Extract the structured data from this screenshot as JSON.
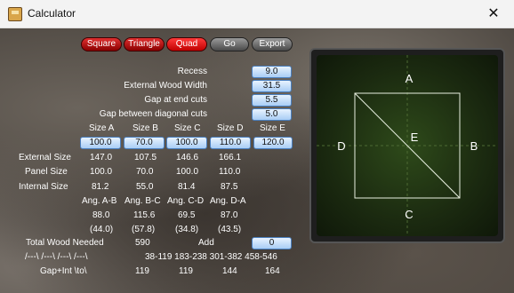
{
  "window": {
    "title": "Calculator",
    "close_glyph": "✕"
  },
  "toolbar": {
    "square": "Square",
    "triangle": "Triangle",
    "quad": "Quad",
    "go": "Go",
    "export": "Export"
  },
  "params": [
    {
      "label": "Recess",
      "value": "9.0"
    },
    {
      "label": "External Wood Width",
      "value": "31.5"
    },
    {
      "label": "Gap at end cuts",
      "value": "5.5"
    },
    {
      "label": "Gap between diagonal cuts",
      "value": "5.0"
    }
  ],
  "sizes": {
    "headers": [
      "Size A",
      "Size B",
      "Size C",
      "Size D",
      "Size E"
    ],
    "inputs": [
      "100.0",
      "70.0",
      "100.0",
      "110.0",
      "120.0"
    ]
  },
  "rows": [
    {
      "label": "External Size",
      "values": [
        "147.0",
        "107.5",
        "146.6",
        "166.1"
      ]
    },
    {
      "label": "Panel Size",
      "values": [
        "100.0",
        "70.0",
        "100.0",
        "110.0"
      ]
    },
    {
      "label": "Internal Size",
      "values": [
        "81.2",
        "55.0",
        "81.4",
        "87.5"
      ]
    }
  ],
  "angles": {
    "headers": [
      "Ang. A-B",
      "Ang. B-C",
      "Ang. C-D",
      "Ang. D-A"
    ],
    "values": [
      "88.0",
      "115.6",
      "69.5",
      "87.0"
    ],
    "paren": [
      "(44.0)",
      "(57.8)",
      "(34.8)",
      "(43.5)"
    ]
  },
  "total": {
    "label": "Total Wood Needed",
    "value": "590",
    "add_label": "Add",
    "add_value": "0"
  },
  "cuts": {
    "pattern": "/---\\ /---\\ /---\\ /---\\",
    "ranges": "38-119 183-238 301-382 458-546",
    "gap_label": "Gap+Int \\to\\",
    "gaps": [
      "119",
      "119",
      "144",
      "164"
    ]
  },
  "diagram": {
    "labels": {
      "top": "A",
      "right": "B",
      "bottom": "C",
      "left": "D",
      "center": "E"
    }
  },
  "colors": {
    "accent_red": "#d01010",
    "field_blue": "#a9cdf5",
    "diagram_bg": "#1b2a10"
  }
}
